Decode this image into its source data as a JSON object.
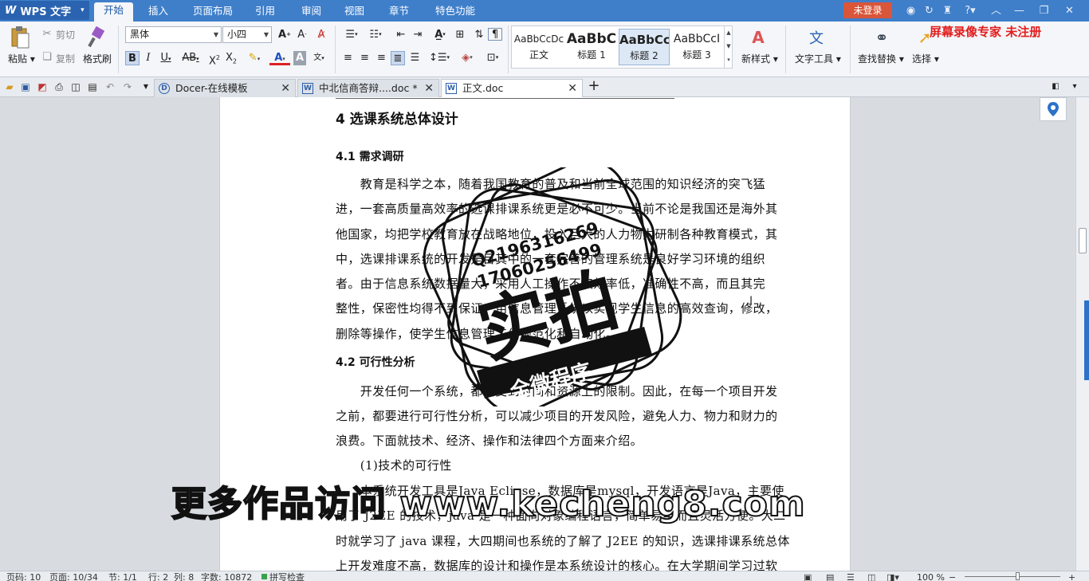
{
  "app": {
    "title": "WPS 文字",
    "login": "未登录",
    "recorder_watermark": "屏幕录像专家 未注册"
  },
  "menu": {
    "tabs": [
      "开始",
      "插入",
      "页面布局",
      "引用",
      "审阅",
      "视图",
      "章节",
      "特色功能"
    ]
  },
  "ribbon": {
    "paste": "粘贴",
    "cut": "剪切",
    "copy": "复制",
    "format_painter": "格式刷",
    "font_name": "黑体",
    "font_size": "小四",
    "styles": [
      {
        "sample": "AaBbCcDc",
        "name": "正文"
      },
      {
        "sample": "AaBbC",
        "name": "标题 1"
      },
      {
        "sample": "AaBbCc",
        "name": "标题 2"
      },
      {
        "sample": "AaBbCcI",
        "name": "标题 3"
      }
    ],
    "new_style": "新样式",
    "text_tools": "文字工具",
    "find_replace": "查找替换",
    "select": "选择"
  },
  "tabs": [
    {
      "label": "Docer-在线模板",
      "active": false
    },
    {
      "label": "中北信商答辩....doc *",
      "active": false
    },
    {
      "label": "正文.doc",
      "active": true
    }
  ],
  "document": {
    "h1": "4   选课系统总体设计",
    "h2a": "4.1 需求调研",
    "p1": [
      "　　教育是科学之本，随着我国教育的普及和当前全球范围的知识经济的突飞猛",
      "进，一套高质量高效率的选课排课系统更是必不可少。当前不论是我国还是海外其",
      "他国家，均把学校教育放在战略地位，投入巨大的人力物力研制各种教育模式，其",
      "中，选课排课系统的开发是目其中的一套完善的管理系统是良好学习环境的组织",
      "者。由于信息系统数据量大，采用人工操作不仅效率低，准确性不高，而且其完",
      "整性，保密性均得不到保证。用信息管理系统以实现学生信息的高效查询，修改，",
      "删除等操作，使学生信息管理工作规范化和自动化。"
    ],
    "h2b": "4.2 可行性分析",
    "p2": [
      "　　开发任何一个系统，都会受到时间和资源上的限制。因此，在每一个项目开发",
      "之前，都要进行可行性分析，可以减少项目的开发风险，避免人力、物力和财力的",
      "浪费。下面就技术、经济、操作和法律四个方面来介绍。"
    ],
    "item1": "　　(1)技术的可行性",
    "p3": [
      "　　本系统开发工具是Java  Eclipse，数据库是mysql，开发语言是Java，主要使",
      "用了 J2EE 的技术，java 是一种面向对象编程语言，简单易学而且灵活方便。大二",
      "时就学习了 java 课程，大四期间也系统的了解了 J2EE 的知识，选课排课系统总体",
      "上开发难度不高，数据库的设计和操作是本系统设计的核心。在大学期间学习过软"
    ]
  },
  "stamp": {
    "qq": "Q2196316269",
    "phone": "17060256499",
    "main": "实拍",
    "banner": "全微程序"
  },
  "overlay": "更多作品访问 www.kecheng8.com",
  "status": {
    "page": "页码: 10",
    "pages": "页面: 10/34",
    "section": "节: 1/1",
    "row": "行: 2",
    "col": "列: 8",
    "words": "字数: 10872",
    "spell": "拼写检查",
    "zoom": "100 %"
  }
}
